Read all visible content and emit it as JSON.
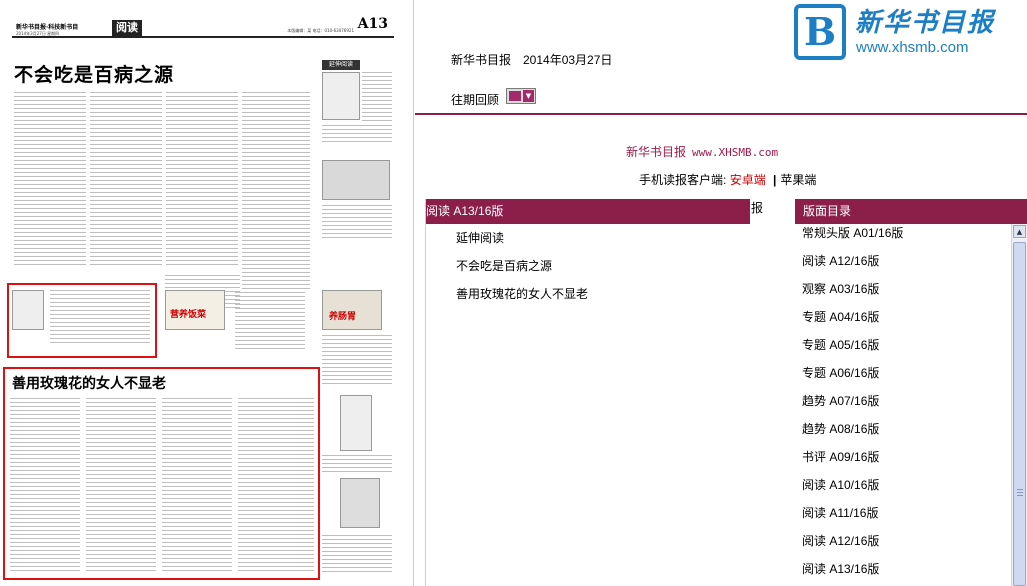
{
  "newspaper": {
    "brand": "新华书目报·科技新书目",
    "section_tag": "阅读",
    "page_number": "A13",
    "date_line": "2014年3月27日 星期四",
    "meta_line": "本版编辑：某 电话：010-63076921",
    "headline_main": "不会吃是百病之源",
    "sidebar_tag": "延伸阅读",
    "headline_rose": "善用玫瑰花的女人不显老",
    "mini_title_1": "营养饭菜",
    "mini_title_2": "养肠胃"
  },
  "site": {
    "logo_letter": "B",
    "logo_name": "新华书目报",
    "logo_url": "www.xhsmb.com",
    "header_title": "新华书目报　2014年03月27日",
    "past_issues_label": "往期回顾",
    "brand_line_name": "新华书目报",
    "brand_line_url": "www.XHSMB.com",
    "mobile_label": "手机读报客户端:",
    "mobile_android": "安卓端",
    "mobile_sep": "|",
    "mobile_apple": "苹果端",
    "truncated_text": "报"
  },
  "articles_panel": {
    "title": "阅读 A13/16版",
    "items": [
      "延伸阅读",
      "不会吃是百病之源",
      "善用玫瑰花的女人不显老"
    ]
  },
  "directory_panel": {
    "title": "版面目录",
    "items": [
      "常规头版 A01/16版",
      "阅读 A12/16版",
      "观察 A03/16版",
      "专题 A04/16版",
      "专题 A05/16版",
      "专题 A06/16版",
      "趋势 A07/16版",
      "趋势 A08/16版",
      "书评 A09/16版",
      "阅读 A10/16版",
      "阅读 A11/16版",
      "阅读 A12/16版",
      "阅读 A13/16版"
    ]
  },
  "colors": {
    "panel_header": "#8b1f4a",
    "logo_blue": "#1c7fc6",
    "link_red": "#c00",
    "highlight_box": "#d11"
  }
}
